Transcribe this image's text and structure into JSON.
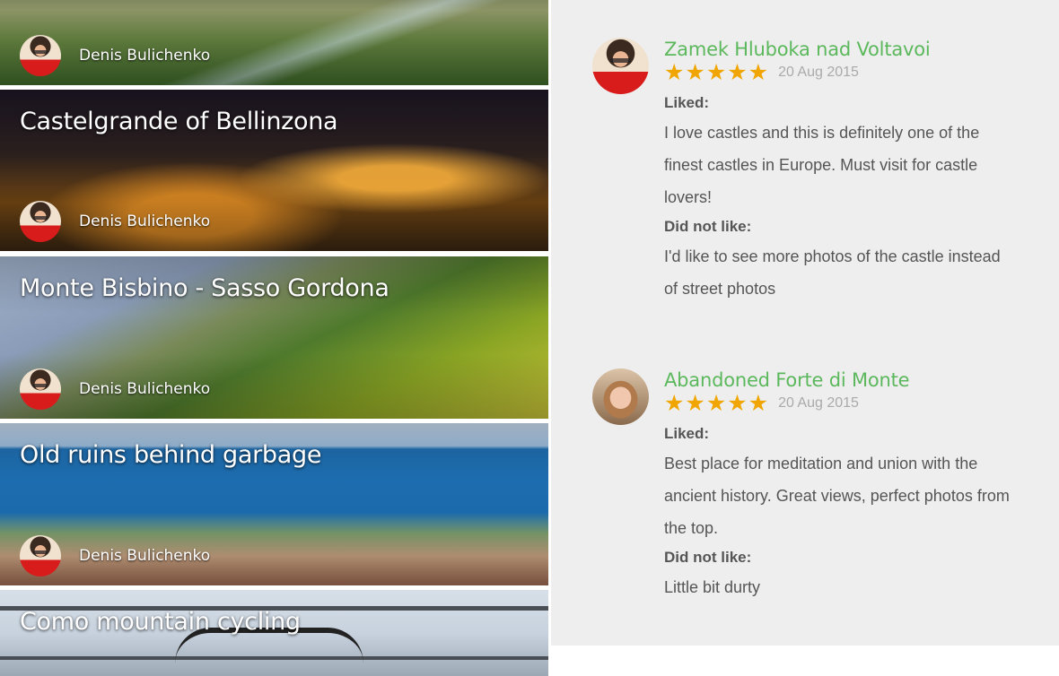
{
  "cards": [
    {
      "title": "",
      "author": "Denis Bulichenko"
    },
    {
      "title": "Castelgrande of Bellinzona",
      "author": "Denis Bulichenko"
    },
    {
      "title": "Monte Bisbino - Sasso Gordona",
      "author": "Denis Bulichenko"
    },
    {
      "title": "Old ruins behind garbage",
      "author": "Denis Bulichenko"
    },
    {
      "title": "Como mountain cycling",
      "author": ""
    }
  ],
  "reviews": [
    {
      "place": "Zamek Hluboka nad Voltavoi",
      "stars": "★★★★★",
      "rating": 5,
      "date": "20 Aug 2015",
      "liked_label": "Liked:",
      "liked_lines": [
        "I love castles and this is definitely one of the",
        "finest castles in Europe. Must visit for castle",
        "lovers!"
      ],
      "disliked_label": "Did not like:",
      "disliked_lines": [
        "I'd like to see more photos of the castle instead",
        "of street photos"
      ]
    },
    {
      "place": "Abandoned Forte di Monte",
      "stars": "★★★★★",
      "rating": 5,
      "date": "20 Aug 2015",
      "liked_label": "Liked:",
      "liked_lines": [
        "Best place for meditation and union with the",
        "ancient history. Great views, perfect photos from",
        "the top."
      ],
      "disliked_label": "Did not like:",
      "disliked_lines": [
        "Little bit durty"
      ]
    }
  ],
  "colors": {
    "review_title": "#5cb85c",
    "star": "#f0a500",
    "review_panel_bg": "#eeeeee"
  }
}
